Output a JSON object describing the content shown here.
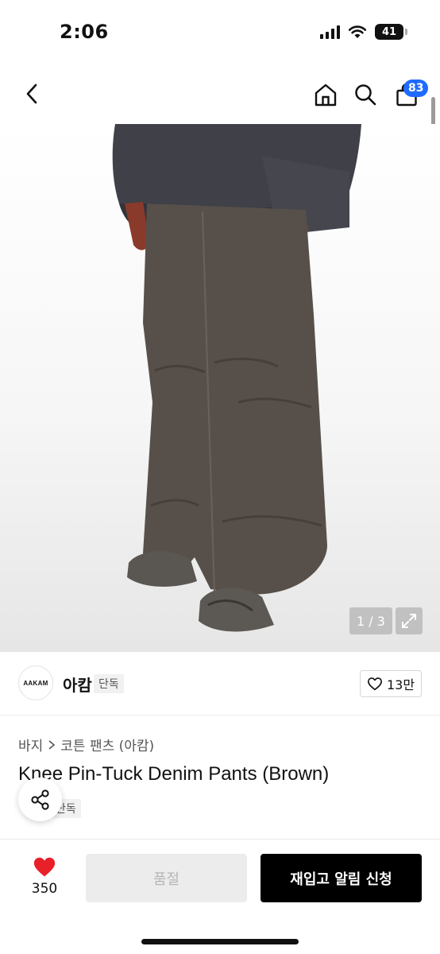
{
  "status_bar": {
    "time": "2:06",
    "battery": "41"
  },
  "nav": {
    "cart_count": "83"
  },
  "gallery": {
    "counter": "1 / 3"
  },
  "brand": {
    "logo_text": "AAKAM",
    "name": "아캄",
    "tag": "단독",
    "likes": "13만"
  },
  "product": {
    "breadcrumb": [
      "바지",
      "코튼 팬츠 (아캄)"
    ],
    "title": "Knee Pin-Tuck Denim Pants (Brown)",
    "exclusive_tag": "단독"
  },
  "bottom": {
    "heart_count": "350",
    "sold_out_label": "품절",
    "notify_label": "재입고 알림 신청"
  },
  "colors": {
    "accent": "#1f6bff",
    "heart": "#e8202a",
    "primary_button": "#000000",
    "disabled_button": "#ececec"
  },
  "icons": [
    "back-icon",
    "home-icon",
    "search-icon",
    "bag-icon",
    "expand-icon",
    "heart-outline-icon",
    "share-icon",
    "heart-filled-icon"
  ]
}
